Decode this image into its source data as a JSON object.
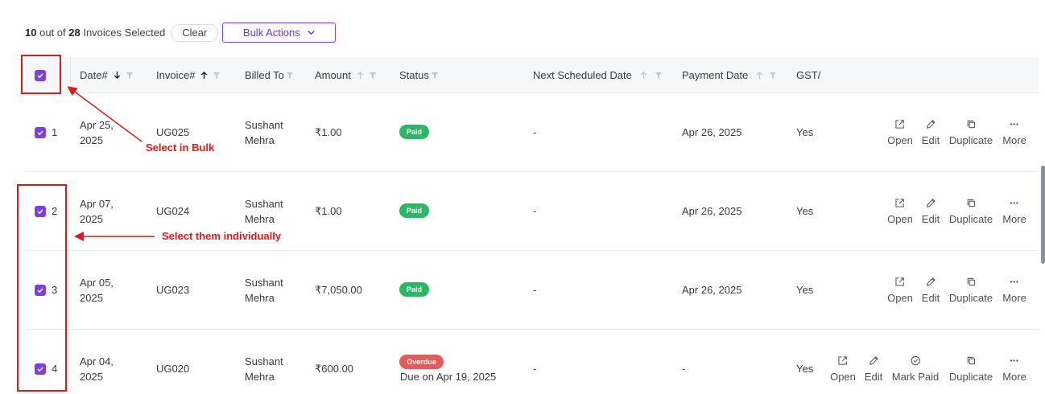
{
  "selection": {
    "selected_count": "10",
    "out_of": "out of",
    "total": "28",
    "suffix": "Invoices Selected",
    "clear_label": "Clear",
    "bulk_actions_label": "Bulk Actions"
  },
  "columns": {
    "date": "Date#",
    "invoice": "Invoice#",
    "billed_to": "Billed To",
    "amount": "Amount",
    "status": "Status",
    "next_scheduled": "Next Scheduled Date",
    "payment_date": "Payment Date",
    "gst": "GST/"
  },
  "actions": {
    "open": "Open",
    "edit": "Edit",
    "mark_paid": "Mark Paid",
    "duplicate": "Duplicate",
    "more": "More"
  },
  "rows": [
    {
      "num": "1",
      "date_line1": "Apr 25,",
      "date_line2": "2025",
      "invoice": "UG025",
      "billed_line1": "Sushant",
      "billed_line2": "Mehra",
      "amount": "₹1.00",
      "status": "Paid",
      "due": "",
      "next_scheduled": "-",
      "payment_date": "Apr 26, 2025",
      "gst": "Yes"
    },
    {
      "num": "2",
      "date_line1": "Apr 07,",
      "date_line2": "2025",
      "invoice": "UG024",
      "billed_line1": "Sushant",
      "billed_line2": "Mehra",
      "amount": "₹1.00",
      "status": "Paid",
      "due": "",
      "next_scheduled": "-",
      "payment_date": "Apr 26, 2025",
      "gst": "Yes"
    },
    {
      "num": "3",
      "date_line1": "Apr 05,",
      "date_line2": "2025",
      "invoice": "UG023",
      "billed_line1": "Sushant",
      "billed_line2": "Mehra",
      "amount": "₹7,050.00",
      "status": "Paid",
      "due": "",
      "next_scheduled": "-",
      "payment_date": "Apr 26, 2025",
      "gst": "Yes"
    },
    {
      "num": "4",
      "date_line1": "Apr 04,",
      "date_line2": "2025",
      "invoice": "UG020",
      "billed_line1": "Sushant",
      "billed_line2": "Mehra",
      "amount": "₹600.00",
      "status": "Overdue",
      "due": "Due on Apr 19, 2025",
      "next_scheduled": "-",
      "payment_date": "-",
      "gst": "Yes"
    }
  ],
  "annotations": {
    "bulk": "Select in Bulk",
    "individual": "Select them individually"
  },
  "colors": {
    "accent": "#7b3fe4",
    "paid": "#29b865",
    "overdue": "#e85a5a",
    "annotation": "#e01919"
  }
}
